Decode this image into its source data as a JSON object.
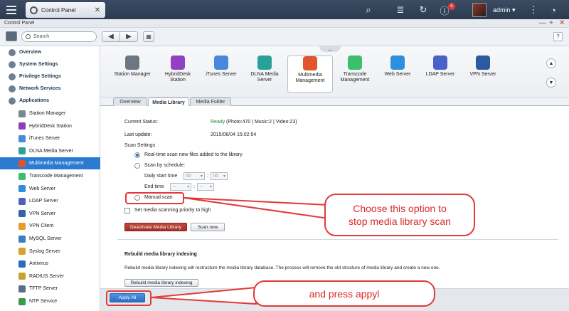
{
  "topbar": {
    "tab_label": "Control Panel",
    "notification_count": "5",
    "user": "admin ▾"
  },
  "window": {
    "title": "Control Panel",
    "controls": [
      "—",
      "+",
      "✕"
    ]
  },
  "toolbar": {
    "search_placeholder": "Search",
    "back": "◀",
    "forward": "▶",
    "grid": "▦",
    "help": "?"
  },
  "sidebar": {
    "top_items": [
      {
        "label": "Overview",
        "icon": "home-icon",
        "color": "#6f7f93"
      },
      {
        "label": "System Settings",
        "icon": "gear-icon",
        "color": "#6f7f93"
      },
      {
        "label": "Privilege Settings",
        "icon": "user-icon",
        "color": "#6f7f93"
      },
      {
        "label": "Network Services",
        "icon": "globe-icon",
        "color": "#6f7f93"
      },
      {
        "label": "Applications",
        "icon": "apps-icon",
        "color": "#6f7f93"
      }
    ],
    "sub_items": [
      {
        "label": "Station Manager",
        "color": "#7b8590"
      },
      {
        "label": "HybridDesk Station",
        "color": "#8e3fb6"
      },
      {
        "label": "iTunes Server",
        "color": "#4a88d9"
      },
      {
        "label": "DLNA Media Server",
        "color": "#2aa198"
      },
      {
        "label": "Multimedia Management",
        "color": "#e0542e"
      },
      {
        "label": "Transcode Management",
        "color": "#3bbf6a"
      },
      {
        "label": "Web Server",
        "color": "#2e8ee0"
      },
      {
        "label": "LDAP Server",
        "color": "#4a62c8"
      },
      {
        "label": "VPN Server",
        "color": "#3464a8"
      },
      {
        "label": "VPN Client",
        "color": "#e89a2a"
      },
      {
        "label": "MySQL Server",
        "color": "#3a7fc0"
      },
      {
        "label": "Syslog Server",
        "color": "#d9a02e"
      },
      {
        "label": "Antivirus",
        "color": "#2a6cc0"
      },
      {
        "label": "RADIUS Server",
        "color": "#c8a22e"
      },
      {
        "label": "TFTP Server",
        "color": "#5a6e86"
      },
      {
        "label": "NTP Service",
        "color": "#3a9a4a"
      }
    ]
  },
  "apps": [
    {
      "label": "Station Manager",
      "color": "#6d7783"
    },
    {
      "label": "HybridDesk\nStation",
      "color": "#9240c2"
    },
    {
      "label": "iTunes Server",
      "color": "#4a88d9"
    },
    {
      "label": "DLNA Media\nServer",
      "color": "#2aa198"
    },
    {
      "label": "Multimedia\nManagement",
      "color": "#e0542e"
    },
    {
      "label": "Transcode\nManagement",
      "color": "#3bbf6a"
    },
    {
      "label": "Web Server",
      "color": "#2e8ee0"
    },
    {
      "label": "LDAP Server",
      "color": "#4a62c8"
    },
    {
      "label": "VPN Server",
      "color": "#2c5aa0"
    }
  ],
  "tabs": [
    "Overview",
    "Media Library",
    "Media Folder"
  ],
  "content": {
    "current_status_label": "Current Status:",
    "status_ready": "Ready",
    "status_counts": "(Photo:470 | Music:2 | Video:23)",
    "last_update_label": "Last update:",
    "last_update_value": "2015/06/04 15:02:54",
    "scan_settings_label": "Scan Settings",
    "opt_realtime": "Real-time scan new files added to the library",
    "opt_schedule": "Scan by schedule:",
    "daily_start": "Daily start time",
    "end_time": "End time",
    "start_h": "00",
    "start_m": "00",
    "end_h": "--",
    "end_m": "--",
    "colon": ":",
    "opt_manual": "Manual scan",
    "priority": "Set media scanning priority to high",
    "btn_deactivate": "Deactivate Media Library",
    "btn_scan": "Scan now",
    "rebuild_title": "Rebuild media library indexing",
    "rebuild_desc": "Rebuild media library indexing will restructure the media library database. The process will remove the old structure of media library and create a new one.",
    "btn_rebuild": "Rebuild media library indexing"
  },
  "footer": {
    "apply": "Apply All"
  },
  "annotations": {
    "callout1": "Choose this option to\nstop media library scan",
    "callout2": "and press appyl",
    "color": "#e13a3a"
  }
}
